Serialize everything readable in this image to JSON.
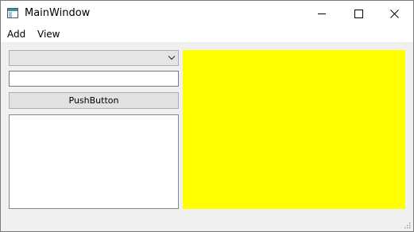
{
  "window": {
    "title": "MainWindow",
    "icon": "app-window-icon",
    "controls": {
      "minimize_icon": "minimize-icon",
      "maximize_icon": "maximize-icon",
      "close_icon": "close-icon"
    }
  },
  "menubar": {
    "items": [
      {
        "label": "Add"
      },
      {
        "label": "View"
      }
    ]
  },
  "sidebar": {
    "combo": {
      "value": "",
      "arrow_icon": "chevron-down-icon"
    },
    "line_edit": {
      "value": "",
      "placeholder": ""
    },
    "push_button": {
      "label": "PushButton"
    },
    "list": {
      "items": []
    }
  },
  "canvas": {
    "fill_color": "#ffff00"
  },
  "colors": {
    "window_bg": "#f0f0f0",
    "titlebar_bg": "#ffffff",
    "canvas": "#ffff00"
  }
}
